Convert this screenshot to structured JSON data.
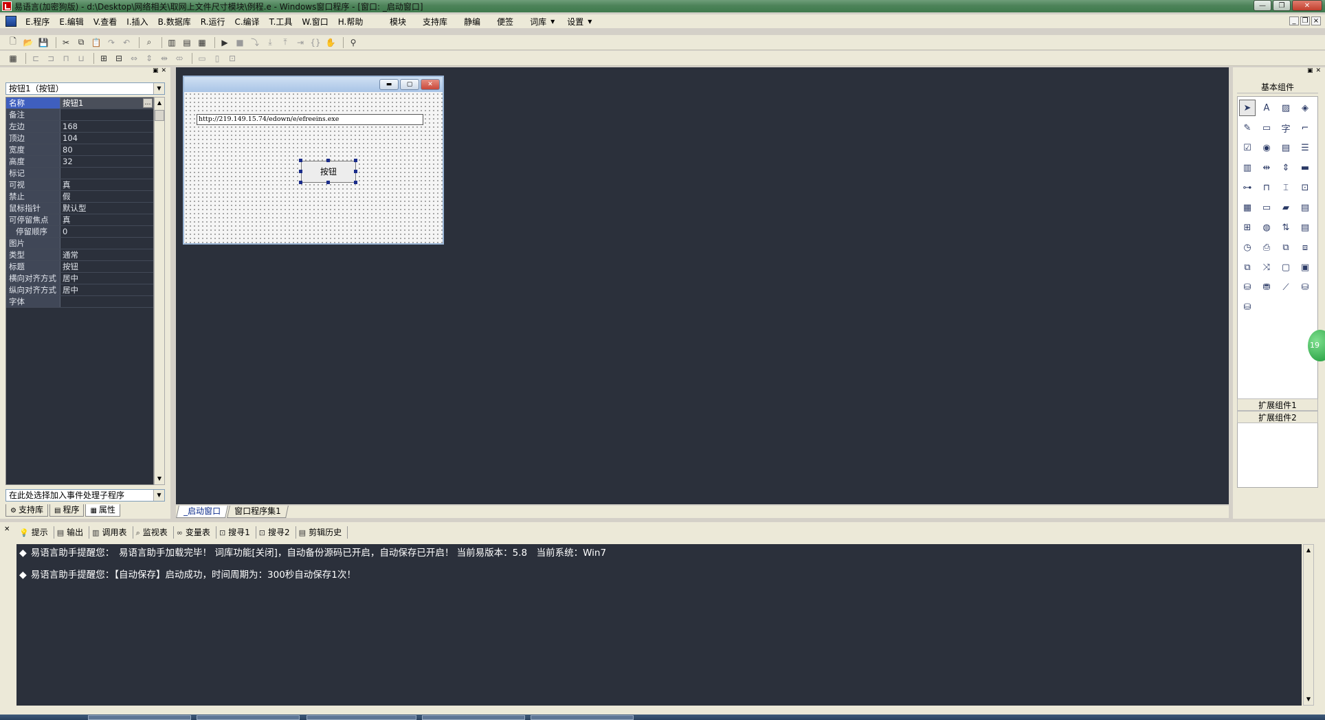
{
  "window": {
    "title": "易语言(加密狗版) - d:\\Desktop\\网络相关\\取网上文件尺寸模块\\例程.e - Windows窗口程序 - [窗口: _启动窗口]"
  },
  "menu": {
    "items": [
      "E.程序",
      "E.编辑",
      "V.查看",
      "I.插入",
      "B.数据库",
      "R.运行",
      "C.编译",
      "T.工具",
      "W.窗口",
      "H.帮助"
    ],
    "right_items": [
      "模块",
      "支持库",
      "静编",
      "便签",
      "词库",
      "设置"
    ]
  },
  "properties": {
    "object_selector": "按钮1（按钮）",
    "rows": [
      {
        "name": "名称",
        "value": "按钮1"
      },
      {
        "name": "备注",
        "value": ""
      },
      {
        "name": "左边",
        "value": "168"
      },
      {
        "name": "顶边",
        "value": "104"
      },
      {
        "name": "宽度",
        "value": "80"
      },
      {
        "name": "高度",
        "value": "32"
      },
      {
        "name": "标记",
        "value": ""
      },
      {
        "name": "可视",
        "value": "真"
      },
      {
        "name": "禁止",
        "value": "假"
      },
      {
        "name": "鼠标指针",
        "value": "默认型"
      },
      {
        "name": "可停留焦点",
        "value": "真"
      },
      {
        "name": "停留顺序",
        "value": "0"
      },
      {
        "name": "图片",
        "value": ""
      },
      {
        "name": "类型",
        "value": "通常"
      },
      {
        "name": "标题",
        "value": "按钮"
      },
      {
        "name": "横向对齐方式",
        "value": "居中"
      },
      {
        "name": "纵向对齐方式",
        "value": "居中"
      },
      {
        "name": "字体",
        "value": ""
      }
    ],
    "event_selector": "在此处选择加入事件处理子程序",
    "tabs": [
      "支持库",
      "程序",
      "属性"
    ]
  },
  "designer": {
    "edit_text": "http://219.149.15.74/edown/e/efreeins.exe",
    "button_text": "按钮",
    "doc_tabs": [
      "_启动窗口",
      "窗口程序集1"
    ]
  },
  "components": {
    "title": "基本组件",
    "ext1": "扩展组件1",
    "ext2": "扩展组件2",
    "badge": "19"
  },
  "output": {
    "tabs": [
      "提示",
      "输出",
      "调用表",
      "监视表",
      "变量表",
      "搜寻1",
      "搜寻2",
      "剪辑历史"
    ],
    "lines": [
      "易语言助手提醒您：　易语言助手加载完毕！ 词库功能[关闭]，自动备份源码已开启，自动保存已开启！ 当前易版本：5.8　当前系统：Win7",
      "易语言助手提醒您：【自动保存】启动成功，时间周期为：300秒自动保存1次！"
    ]
  }
}
